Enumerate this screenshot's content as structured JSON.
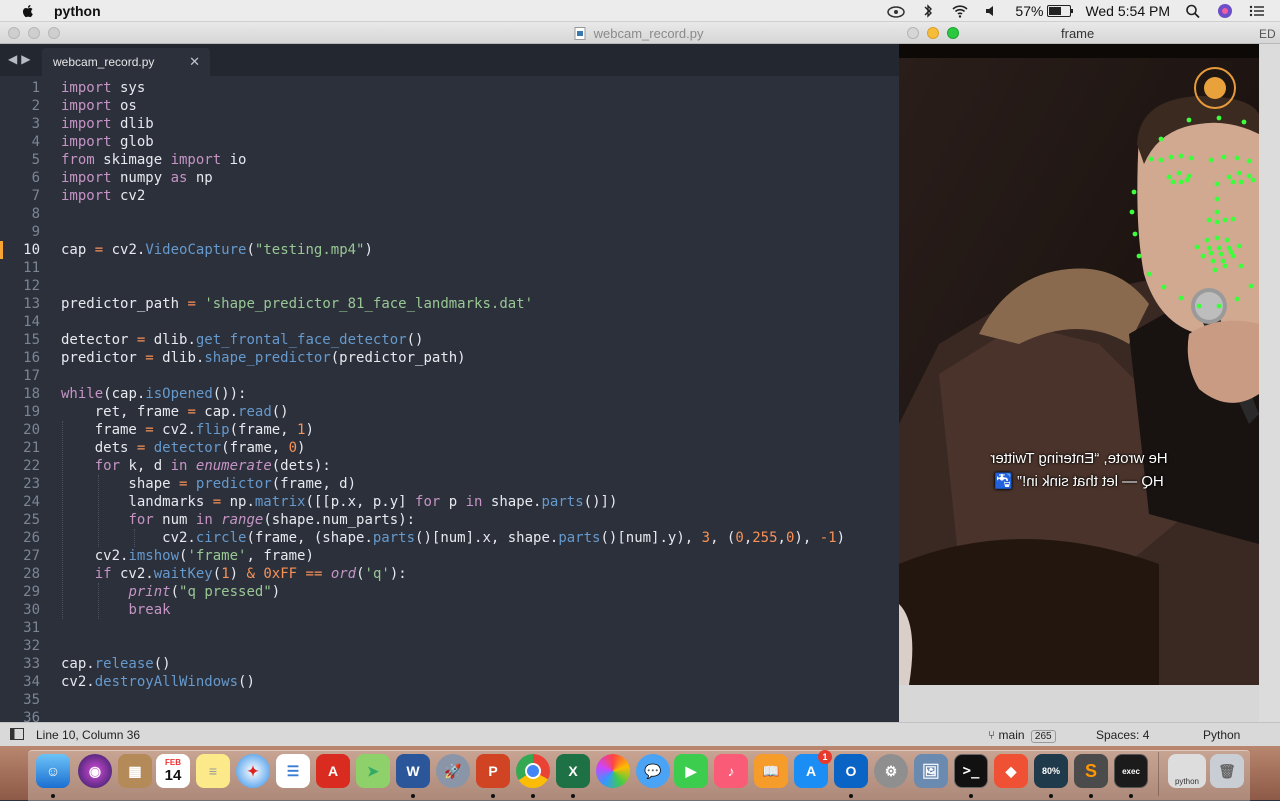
{
  "menubar": {
    "app_name": "python",
    "battery_percent": "57%",
    "battery_level": 0.57,
    "clock": "Wed 5:54 PM"
  },
  "editor": {
    "window_title": "webcam_record.py",
    "tab_label": "webcam_record.py",
    "current_line": 10,
    "line_numbers": [
      "1",
      "2",
      "3",
      "4",
      "5",
      "6",
      "7",
      "8",
      "9",
      "10",
      "11",
      "12",
      "13",
      "14",
      "15",
      "16",
      "17",
      "18",
      "19",
      "20",
      "21",
      "22",
      "23",
      "24",
      "25",
      "26",
      "27",
      "28",
      "29",
      "30",
      "31",
      "32",
      "33",
      "34",
      "35",
      "36"
    ]
  },
  "statusbar": {
    "position": "Line 10, Column 36",
    "branch": "main",
    "branch_count": "265",
    "indent": "Spaces: 4",
    "syntax": "Python"
  },
  "frame_window": {
    "title": "frame",
    "corner_label": "ED",
    "subtitle_line1": "He wrote, “Entering Twitter",
    "subtitle_line2": "HQ — let that sink in!” 🚰"
  },
  "dock": {
    "calendar_month": "FEB",
    "calendar_day": "14",
    "app_store_badge": "1",
    "python_label": "python",
    "progress_label": "80%"
  }
}
